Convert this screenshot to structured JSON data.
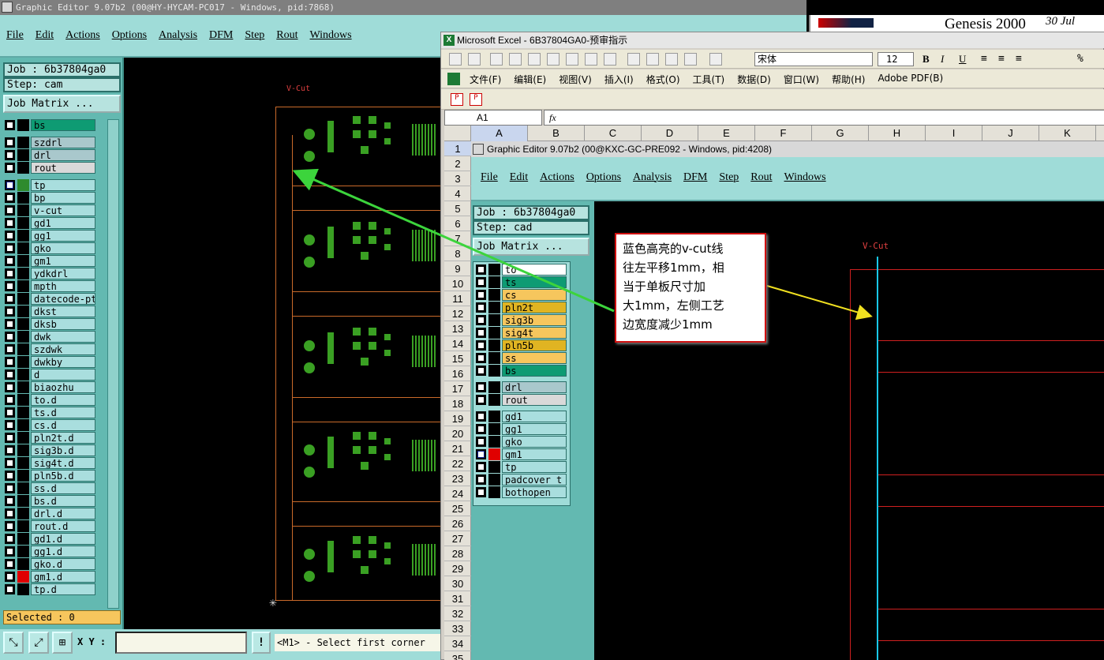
{
  "bg_window": {
    "title": "Graphic Editor 9.07b2 (00@HY-HYCAM-PC017 - Windows, pid:7868)",
    "menu": [
      "File",
      "Edit",
      "Actions",
      "Options",
      "Analysis",
      "DFM",
      "Step",
      "Rout",
      "Windows"
    ],
    "job": "Job : 6b37804ga0",
    "step": "Step: cam",
    "job_matrix": "Job Matrix ...",
    "layers": [
      {
        "name": "bs",
        "color": "#0e9b73"
      },
      {
        "name": "szdrl",
        "color": "#a9c8cc"
      },
      {
        "name": "drl",
        "color": "#a9c8cc"
      },
      {
        "name": "rout",
        "color": "#d9d9d9"
      },
      {
        "name": "tp",
        "color": "#a9dede"
      },
      {
        "name": "bp",
        "color": "#a9dede"
      },
      {
        "name": "v-cut",
        "color": "#a9dede"
      },
      {
        "name": "gd1",
        "color": "#a9dede"
      },
      {
        "name": "gg1",
        "color": "#a9dede"
      },
      {
        "name": "gko",
        "color": "#a9dede"
      },
      {
        "name": "gm1",
        "color": "#a9dede"
      },
      {
        "name": "ydkdrl",
        "color": "#a9dede"
      },
      {
        "name": "mpth",
        "color": "#a9dede"
      },
      {
        "name": "datecode-pte",
        "color": "#a9dede"
      },
      {
        "name": "dkst",
        "color": "#a9dede"
      },
      {
        "name": "dksb",
        "color": "#a9dede"
      },
      {
        "name": "dwk",
        "color": "#a9dede"
      },
      {
        "name": "szdwk",
        "color": "#a9dede"
      },
      {
        "name": "dwkby",
        "color": "#a9dede"
      },
      {
        "name": "d",
        "color": "#a9dede"
      },
      {
        "name": "biaozhu",
        "color": "#a9dede"
      },
      {
        "name": "to.d",
        "color": "#a9dede"
      },
      {
        "name": "ts.d",
        "color": "#a9dede"
      },
      {
        "name": "cs.d",
        "color": "#a9dede"
      },
      {
        "name": "pln2t.d",
        "color": "#a9dede"
      },
      {
        "name": "sig3b.d",
        "color": "#a9dede"
      },
      {
        "name": "sig4t.d",
        "color": "#a9dede"
      },
      {
        "name": "pln5b.d",
        "color": "#a9dede"
      },
      {
        "name": "ss.d",
        "color": "#a9dede"
      },
      {
        "name": "bs.d",
        "color": "#a9dede"
      },
      {
        "name": "drl.d",
        "color": "#a9dede"
      },
      {
        "name": "rout.d",
        "color": "#a9dede"
      },
      {
        "name": "gd1.d",
        "color": "#a9dede"
      },
      {
        "name": "gg1.d",
        "color": "#a9dede"
      },
      {
        "name": "gko.d",
        "color": "#a9dede"
      },
      {
        "name": "gm1.d",
        "color": "#a9dede"
      },
      {
        "name": "tp.d",
        "color": "#a9dede"
      }
    ],
    "selected": "Selected : 0",
    "xy_label": "X Y :",
    "status": "<M1> - Select first corner",
    "canvas_label": "V-Cut"
  },
  "logo": {
    "text": "Genesis 2000",
    "date": "30 Jul"
  },
  "excel": {
    "title": "Microsoft Excel - 6B37804GA0-预审指示",
    "font_name": "宋体",
    "font_size": "12",
    "menu": [
      "文件(F)",
      "编辑(E)",
      "视图(V)",
      "插入(I)",
      "格式(O)",
      "工具(T)",
      "数据(D)",
      "窗口(W)",
      "帮助(H)",
      "Adobe PDF(B)"
    ],
    "cell_ref": "A1",
    "fx": "fx",
    "columns": [
      "A",
      "B",
      "C",
      "D",
      "E",
      "F",
      "G",
      "H",
      "I",
      "J",
      "K"
    ],
    "rows": [
      "1",
      "2",
      "3",
      "4",
      "5",
      "6",
      "7",
      "8",
      "9",
      "10",
      "11",
      "12",
      "13",
      "14",
      "15",
      "16",
      "17",
      "18",
      "19",
      "20",
      "21",
      "22",
      "23",
      "24",
      "25",
      "26",
      "27",
      "28",
      "29",
      "30",
      "31",
      "32",
      "33",
      "34",
      "35"
    ]
  },
  "embedded": {
    "title": "Graphic Editor 9.07b2 (00@KXC-GC-PRE092 - Windows, pid:4208)",
    "menu": [
      "File",
      "Edit",
      "Actions",
      "Options",
      "Analysis",
      "DFM",
      "Step",
      "Rout",
      "Windows"
    ],
    "job": "Job : 6b37804ga0",
    "step": "Step: cad",
    "job_matrix": "Job Matrix ...",
    "layers": [
      {
        "name": "to",
        "color": "#ffffff"
      },
      {
        "name": "ts",
        "color": "#0e9b73"
      },
      {
        "name": "cs",
        "color": "#f6c65d"
      },
      {
        "name": "pln2t",
        "color": "#e0b422"
      },
      {
        "name": "sig3b",
        "color": "#f6c65d"
      },
      {
        "name": "sig4t",
        "color": "#f6c65d"
      },
      {
        "name": "pln5b",
        "color": "#e0b422"
      },
      {
        "name": "ss",
        "color": "#f6c65d"
      },
      {
        "name": "bs",
        "color": "#0e9b73"
      },
      {
        "name": "drl",
        "color": "#a9c8cc"
      },
      {
        "name": "rout",
        "color": "#d9d9d9"
      },
      {
        "name": "gd1",
        "color": "#a9dede"
      },
      {
        "name": "gg1",
        "color": "#a9dede"
      },
      {
        "name": "gko",
        "color": "#a9dede"
      },
      {
        "name": "gm1",
        "color": "#a9dede"
      },
      {
        "name": "tp",
        "color": "#a9dede"
      },
      {
        "name": "padcover_t",
        "color": "#a9dede"
      },
      {
        "name": "bothopen",
        "color": "#a9dede"
      }
    ],
    "canvas_label": "V-Cut"
  },
  "callout": {
    "line1": "蓝色高亮的v-cut线",
    "line2": "往左平移1mm，相",
    "line3": "当于单板尺寸加",
    "line4": "大1mm，左侧工艺",
    "line5": "边宽度减少1mm"
  }
}
